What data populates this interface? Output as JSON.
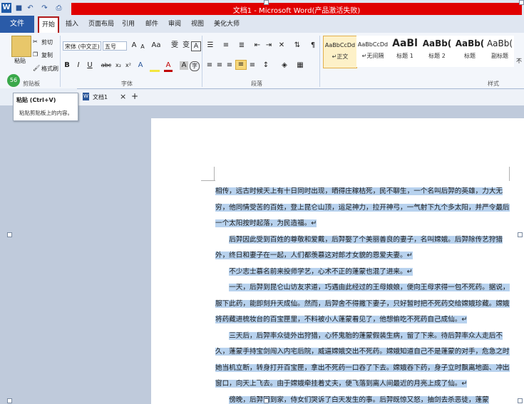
{
  "window": {
    "title": "文档1 - Microsoft Word(产品激活失败)",
    "title_bar_color": "#e00000"
  },
  "quick_access": {
    "logo": "W",
    "icons": [
      "save-icon",
      "undo-icon",
      "redo-icon",
      "print-icon"
    ]
  },
  "tabs": {
    "file": "文件",
    "home": "开始",
    "items": [
      "插入",
      "页面布局",
      "引用",
      "邮件",
      "审阅",
      "视图",
      "美化大师"
    ]
  },
  "clipboard": {
    "paste": "粘贴",
    "cut": "剪切",
    "copy": "复制",
    "format_painter": "格式刷",
    "group_label": "剪贴板"
  },
  "font": {
    "font_name": "宋体 (中文正)",
    "font_size": "五号",
    "group_label": "字体",
    "grow": "A",
    "shrink": "A",
    "bold": "B",
    "italic": "I",
    "underline": "U",
    "strike": "abc",
    "subscript": "x₂",
    "superscript": "x²",
    "text_color": "A"
  },
  "paragraph": {
    "group_label": "段落"
  },
  "styles": {
    "group_label": "样式",
    "items": [
      {
        "sample": "AaBbCcDd",
        "name": "↵正文"
      },
      {
        "sample": "AaBbCcDd",
        "name": "↵无间隔"
      },
      {
        "sample": "AaBl",
        "name": "标题 1"
      },
      {
        "sample": "AaBb(",
        "name": "标题 2"
      },
      {
        "sample": "AaBb(",
        "name": "标题"
      },
      {
        "sample": "AaBb(",
        "name": "副标题"
      },
      {
        "sample": "",
        "name": "不"
      }
    ]
  },
  "badge": "56",
  "tooltip": {
    "title": "粘贴 (Ctrl+V)",
    "body": "粘贴剪贴板上的内容。"
  },
  "document_tab": {
    "label": "文档1",
    "close": "×",
    "add": "+"
  },
  "document": {
    "paragraphs": [
      "相传，远古时候天上有十日同时出现，晒得庄稼枯死，民不聊生，一个名叫后羿的英雄，力大无穷，他同情受苦的百姓，登上昆仑山顶，运足神力，拉开神弓，一气射下九个多太阳，并严令最后一个太阳按时起落，为民造福。↵",
      "后羿因此受到百姓的尊敬和爱戴，后羿娶了个美丽善良的妻子，名叫嫦娥。后羿除传艺狩猎外，终日和妻子在一起，人们都羡慕这对郎才女貌的恩爱夫妻。↵",
      "不少志士慕名前来投师学艺，心术不正的蓬蒙也混了进来。↵",
      "一天，后羿到昆仑山访友求道，巧遇由此经过的王母娘娘，便向王母求得一包不死药。据说，服下此药，能即刻升天成仙。然而，后羿舍不得撇下妻子，只好暂时把不死药交给嫦娥珍藏。嫦娥将药藏进梳妆台的百宝匣里，不料被小人蓬蒙看见了，他想偷吃不死药自己成仙。↵",
      "三天后，后羿率众徒外出狩猎，心怀鬼胎的蓬蒙假装生病，留了下来。待后羿率众人走后不久，蓬蒙手持宝剑闯入内宅后院，威逼嫦娥交出不死药。嫦娥知道自己不是蓬蒙的对手，危急之时她当机立断，转身打开百宝匣，拿出不死药一口吞了下去。嫦娥吞下药，身子立时飘离地面、冲出窗口，向天上飞去。由于嫦娥牵挂着丈夫，便飞落到离人间最近的月亮上成了仙。↵",
      "傍晚，后羿回到家，侍女们哭诉了白天发生的事。后羿既惊又怒，抽剑去杀恶徒，蓬蒙"
    ],
    "highlight_color": "#b8d2ee"
  }
}
